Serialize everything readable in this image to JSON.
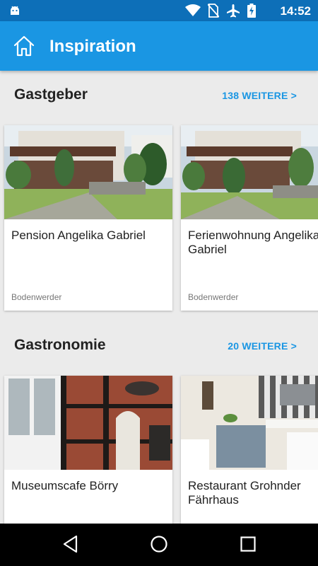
{
  "status_bar": {
    "time": "14:52",
    "icons": [
      "android-icon",
      "wifi-icon",
      "no-sim-icon",
      "airplane-mode-icon",
      "battery-charging-icon"
    ]
  },
  "app_bar": {
    "title": "Inspiration",
    "home_icon": "home-icon"
  },
  "sections": [
    {
      "title": "Gastgeber",
      "more_label": "138 WEITERE >",
      "cards": [
        {
          "name": "Pension Angelika Gabriel",
          "place": "Bodenwerder"
        },
        {
          "name": "Ferienwohnung Angelika Gabriel",
          "place": "Bodenwerder"
        }
      ]
    },
    {
      "title": "Gastronomie",
      "more_label": "20 WEITERE >",
      "cards": [
        {
          "name": "Museumscafe Börry",
          "place": ""
        },
        {
          "name": "Restaurant Grohnder Fährhaus",
          "place": ""
        }
      ]
    }
  ],
  "nav_bar": {
    "buttons": [
      "back-icon",
      "home-circle-icon",
      "recents-icon"
    ]
  },
  "colors": {
    "status_bar": "#0d6fb8",
    "app_bar": "#1a96e3",
    "accent": "#1a96e3",
    "background": "#ebebeb"
  }
}
